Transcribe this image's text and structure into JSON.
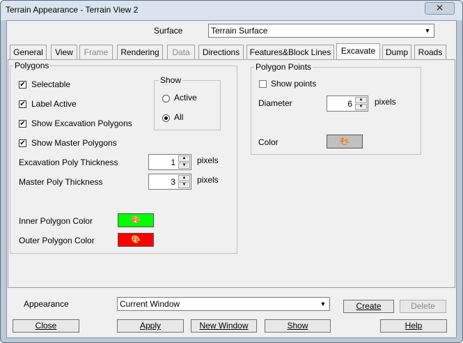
{
  "window": {
    "title": "Terrain Appearance - Terrain View 2",
    "close_glyph": "✕"
  },
  "surface": {
    "label": "Surface",
    "value": "Terrain Surface"
  },
  "tabs": [
    {
      "label": "General"
    },
    {
      "label": "View"
    },
    {
      "label": "Frame"
    },
    {
      "label": "Rendering"
    },
    {
      "label": "Data"
    },
    {
      "label": "Directions"
    },
    {
      "label": "Features&Block Lines"
    },
    {
      "label": "Excavate"
    },
    {
      "label": "Dump"
    },
    {
      "label": "Roads"
    }
  ],
  "polygons": {
    "title": "Polygons",
    "selectable": "Selectable",
    "label_active": "Label Active",
    "show_excavation": "Show Excavation Polygons",
    "show_master": "Show Master Polygons",
    "show_group": {
      "title": "Show",
      "active": "Active",
      "all": "All",
      "selected": "All"
    },
    "excavation_thickness": {
      "label": "Excavation Poly Thickness",
      "value": "1",
      "unit": "pixels"
    },
    "master_thickness": {
      "label": "Master Poly Thickness",
      "value": "3",
      "unit": "pixels"
    },
    "inner_color": {
      "label": "Inner Polygon Color",
      "color": "#00ff00"
    },
    "outer_color": {
      "label": "Outer Polygon Color",
      "color": "#ff0000"
    }
  },
  "polygon_points": {
    "title": "Polygon Points",
    "show_points": "Show points",
    "diameter": {
      "label": "Diameter",
      "value": "6",
      "unit": "pixels"
    },
    "color": {
      "label": "Color",
      "color": "#c0c0c0"
    }
  },
  "appearance": {
    "label": "Appearance",
    "value": "Current Window",
    "create": "Create",
    "delete": "Delete"
  },
  "buttons": {
    "close": "Close",
    "apply": "Apply",
    "new_window": "New Window",
    "show": "Show",
    "help": "Help"
  },
  "checks": {
    "checked": "✔",
    "dropdown_arrow": "▼",
    "up": "▲",
    "down": "▼",
    "palette": "🎨"
  }
}
